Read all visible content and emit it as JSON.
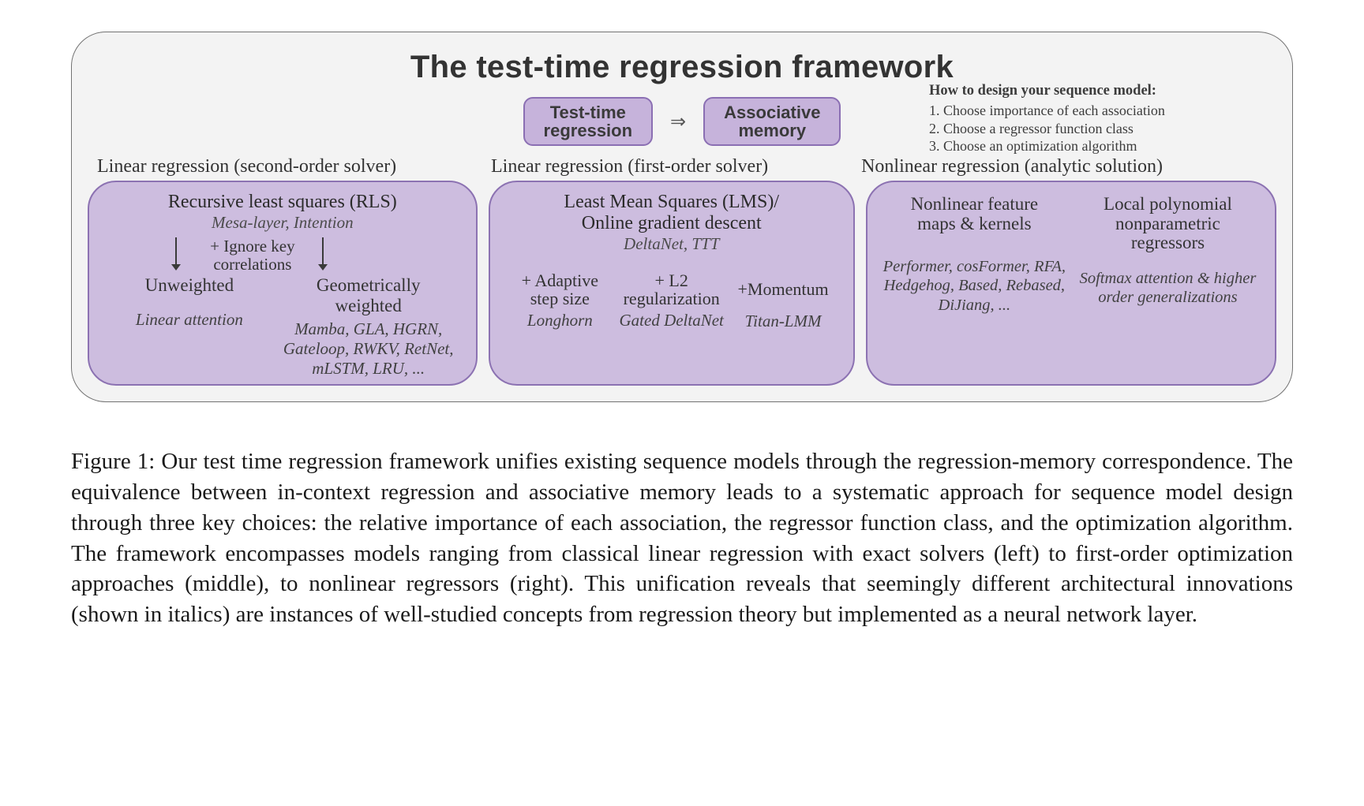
{
  "figure": {
    "title": "The test-time regression framework",
    "top": {
      "pillA_l1": "Test-time",
      "pillA_l2": "regression",
      "arrow": "⇒",
      "pillB_l1": "Associative",
      "pillB_l2": "memory",
      "howto_title": "How to design your sequence model:",
      "howto_1": "1. Choose importance of each association",
      "howto_2": "2. Choose a regressor function class",
      "howto_3": "3. Choose an optimization algorithm"
    },
    "colheaders": {
      "left": "Linear regression (second-order solver)",
      "mid": "Linear regression (first-order solver)",
      "right": "Nonlinear regression (analytic solution)"
    },
    "left": {
      "main": "Recursive least squares (RLS)",
      "sub": "Mesa-layer, Intention",
      "ignore_l1": "+ Ignore key",
      "ignore_l2": "correlations",
      "bottomL_label": "Unweighted",
      "bottomL_models": "Linear attention",
      "bottomR_label_l1": "Geometrically",
      "bottomR_label_l2": "weighted",
      "bottomR_models": "Mamba, GLA, HGRN, Gateloop, RWKV, RetNet, mLSTM, LRU, ..."
    },
    "mid": {
      "main_l1": "Least Mean Squares (LMS)/",
      "main_l2": "Online gradient descent",
      "sub": "DeltaNet, TTT",
      "ext1_l1": "+ Adaptive",
      "ext1_l2": "step size",
      "ext1_model": "Longhorn",
      "ext2_l1": "+ L2",
      "ext2_l2": "regularization",
      "ext2_model": "Gated DeltaNet",
      "ext3_l1": "+Momentum",
      "ext3_model": "Titan-LMM"
    },
    "right": {
      "colA_l1": "Nonlinear feature",
      "colA_l2": "maps & kernels",
      "colA_models": "Performer, cosFormer, RFA, Hedgehog, Based, Rebased, DiJiang, ...",
      "colB_l1": "Local polynomial",
      "colB_l2": "nonparametric",
      "colB_l3": "regressors",
      "colB_models": "Softmax attention & higher order generalizations"
    }
  },
  "caption": {
    "label": "Figure 1:",
    "text": "Our test time regression framework unifies existing sequence models through the regression-memory correspondence. The equivalence between in-context regression and associative memory leads to a systematic approach for sequence model design through three key choices: the relative importance of each association, the regressor function class, and the optimization algorithm. The framework encompasses models ranging from classical linear regression with exact solvers (left) to first-order optimization approaches (middle), to nonlinear regressors (right). This unification reveals that seemingly different architectural innovations (shown in italics) are instances of well-studied concepts from regression theory but implemented as a neural network layer."
  }
}
